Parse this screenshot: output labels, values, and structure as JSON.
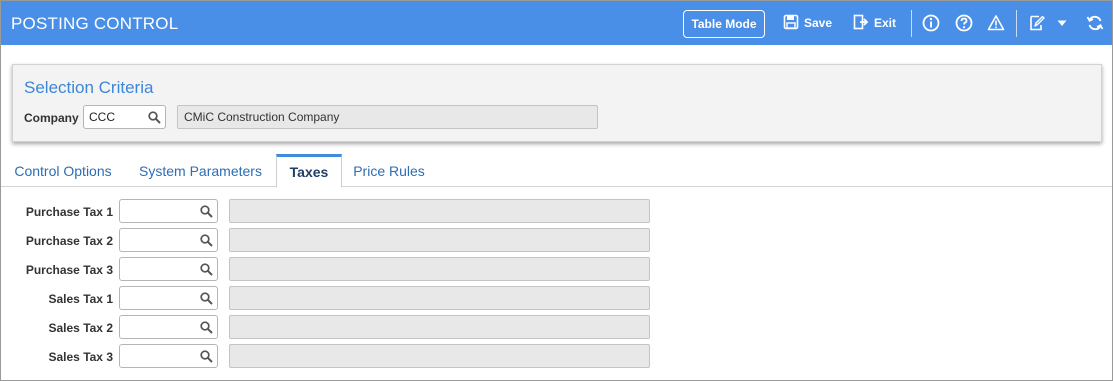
{
  "header": {
    "title": "POSTING CONTROL",
    "table_mode_label": "Table Mode",
    "save_label": "Save",
    "exit_label": "Exit"
  },
  "criteria": {
    "title": "Selection Criteria",
    "company_label": "Company",
    "company_value": "CCC",
    "company_name": "CMiC Construction Company"
  },
  "tabs": [
    {
      "label": "Control Options"
    },
    {
      "label": "System Parameters"
    },
    {
      "label": "Taxes"
    },
    {
      "label": "Price Rules"
    }
  ],
  "active_tab": "Taxes",
  "tax_fields": [
    {
      "label": "Purchase Tax 1",
      "value": "",
      "description": ""
    },
    {
      "label": "Purchase Tax 2",
      "value": "",
      "description": ""
    },
    {
      "label": "Purchase Tax 3",
      "value": "",
      "description": ""
    },
    {
      "label": "Sales Tax 1",
      "value": "",
      "description": ""
    },
    {
      "label": "Sales Tax 2",
      "value": "",
      "description": ""
    },
    {
      "label": "Sales Tax 3",
      "value": "",
      "description": ""
    }
  ],
  "colors": {
    "header_bg": "#4a8fe7",
    "accent": "#3d87d6",
    "active_tab_border": "#3f8be0"
  },
  "icons": [
    "save-icon",
    "exit-icon",
    "info-icon",
    "help-icon",
    "warning-icon",
    "edit-icon",
    "dropdown-icon",
    "refresh-icon",
    "search-icon"
  ]
}
